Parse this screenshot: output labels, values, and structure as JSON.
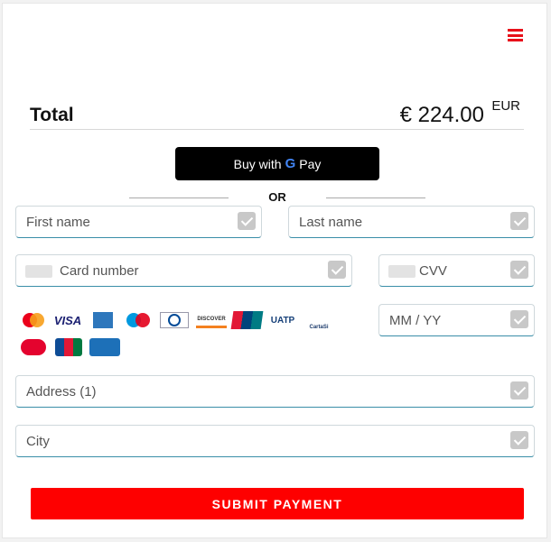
{
  "header": {
    "menu_icon": "hamburger-menu-icon",
    "accent_color": "#e8101a"
  },
  "summary": {
    "total_label": "Total",
    "amount": "€ 224.00",
    "currency": "EUR"
  },
  "gpay": {
    "prefix": "Buy with",
    "g_letter": "G",
    "pay": "Pay"
  },
  "divider": {
    "or": "OR"
  },
  "form": {
    "first_name": {
      "placeholder": "First name"
    },
    "last_name": {
      "placeholder": "Last name"
    },
    "card_number": {
      "placeholder": "Card number"
    },
    "cvv": {
      "placeholder": "CVV"
    },
    "expiry": {
      "placeholder": "MM / YY"
    },
    "address": {
      "placeholder": "Address (1)"
    },
    "city": {
      "placeholder": "City"
    }
  },
  "card_brands": [
    {
      "name": "mastercard-icon",
      "label": ""
    },
    {
      "name": "visa-icon",
      "label": "VISA"
    },
    {
      "name": "amex-icon",
      "label": ""
    },
    {
      "name": "maestro-icon",
      "label": ""
    },
    {
      "name": "diners-club-icon",
      "label": ""
    },
    {
      "name": "discover-icon",
      "label": "DISCOVER"
    },
    {
      "name": "unionpay-icon",
      "label": ""
    },
    {
      "name": "uatp-icon",
      "label": "UATP"
    },
    {
      "name": "cartasi-icon",
      "label": "CartaSi"
    },
    {
      "name": "dankort-icon",
      "label": ""
    },
    {
      "name": "jcb-icon",
      "label": ""
    },
    {
      "name": "cartes-bancaires-icon",
      "label": ""
    }
  ],
  "submit": {
    "label": "SUBMIT PAYMENT",
    "color": "#fe0000"
  }
}
